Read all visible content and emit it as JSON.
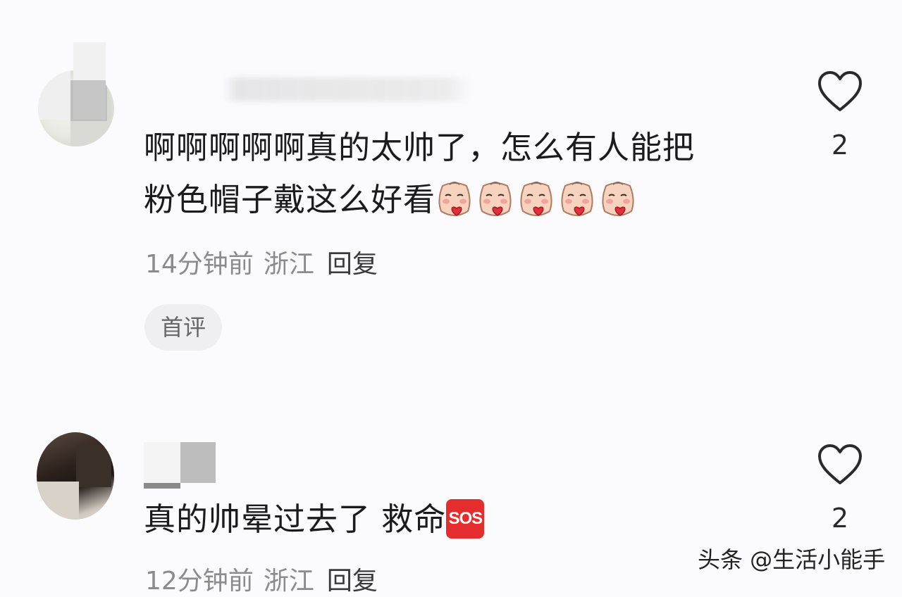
{
  "comments": [
    {
      "text_line1": "啊啊啊啊啊真的太帅了，怎么有人能把",
      "text_line2": "粉色帽子戴这么好看",
      "emoji_count": 5,
      "emoji_icon": "kiss-face-icon",
      "time": "14分钟前",
      "location": "浙江",
      "reply_label": "回复",
      "badge": "首评",
      "likes": "2"
    },
    {
      "text": "真的帅晕过去了 救命",
      "emoji_icon": "sos-icon",
      "emoji_label": "SOS",
      "time": "12分钟前",
      "location": "浙江",
      "reply_label": "回复",
      "likes": "2"
    }
  ],
  "watermark": "头条 @生活小能手",
  "colors": {
    "background": "#fbfbfd",
    "meta_text": "#8b8b8b",
    "sos_red": "#e52d2d",
    "badge_bg": "#efeff2"
  }
}
